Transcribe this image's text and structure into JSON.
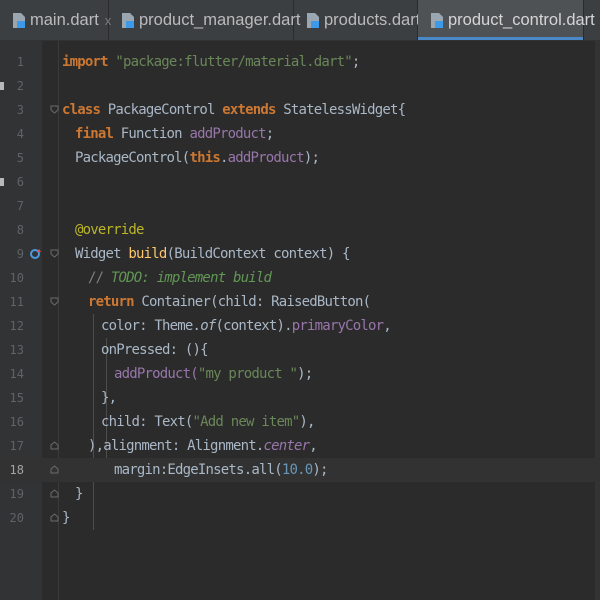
{
  "tabs": [
    {
      "label": "main.dart",
      "close": "x",
      "active": false
    },
    {
      "label": "product_manager.dart",
      "close": "x",
      "active": false
    },
    {
      "label": "products.dart",
      "close": "x",
      "active": false
    },
    {
      "label": "product_control.dart",
      "close": "x",
      "active": true
    }
  ],
  "editor": {
    "current_line": 18,
    "lines": [
      {
        "n": "1"
      },
      {
        "n": "2"
      },
      {
        "n": "3"
      },
      {
        "n": "4"
      },
      {
        "n": "5"
      },
      {
        "n": "6"
      },
      {
        "n": "7"
      },
      {
        "n": "8"
      },
      {
        "n": "9"
      },
      {
        "n": "10"
      },
      {
        "n": "11"
      },
      {
        "n": "12"
      },
      {
        "n": "13"
      },
      {
        "n": "14"
      },
      {
        "n": "15"
      },
      {
        "n": "16"
      },
      {
        "n": "17"
      },
      {
        "n": "18"
      },
      {
        "n": "19"
      },
      {
        "n": "20"
      }
    ]
  },
  "code": {
    "l1": [
      "import",
      " ",
      "\"package:flutter/material.dart\"",
      ";"
    ],
    "l3": [
      "class",
      " PackageControl ",
      "extends",
      " StatelessWidget{"
    ],
    "l4": [
      "final",
      " Function ",
      "addProduct",
      ";"
    ],
    "l5": [
      "PackageControl(",
      "this",
      ".",
      "addProduct",
      ");"
    ],
    "l8": [
      "@override"
    ],
    "l9": [
      "Widget ",
      "build",
      "(BuildContext context) {"
    ],
    "l10": [
      "// ",
      "TODO: implement build"
    ],
    "l11": [
      "return",
      " Container(child: RaisedButton("
    ],
    "l12": [
      "color: Theme.",
      "of",
      "(context).",
      "primaryColor",
      ","
    ],
    "l13": [
      "onPressed: (){"
    ],
    "l14": [
      "addProduct(",
      "\"my product \"",
      ");"
    ],
    "l15": [
      "},"
    ],
    "l16": [
      "child: Text(",
      "\"Add new item\"",
      "),"
    ],
    "l17": [
      "),alignment: Alignment.",
      "center",
      ","
    ],
    "l18": [
      "margin:EdgeInsets.all(",
      "10.0",
      ");"
    ],
    "l19": [
      "}"
    ],
    "l20": [
      "}"
    ]
  },
  "colors": {
    "background": "#2b2b2b",
    "keyword": "#cc7832",
    "string": "#6a8759",
    "property": "#9876aa",
    "comment": "#629755",
    "annotation": "#bbb529",
    "number": "#6897bb",
    "default": "#a9b7c6",
    "tab_accent": "#4a88c7"
  },
  "icons": {
    "file": "dart-file-icon",
    "close": "close-icon",
    "override": "override-marker-icon",
    "fold": "fold-marker-icon"
  }
}
